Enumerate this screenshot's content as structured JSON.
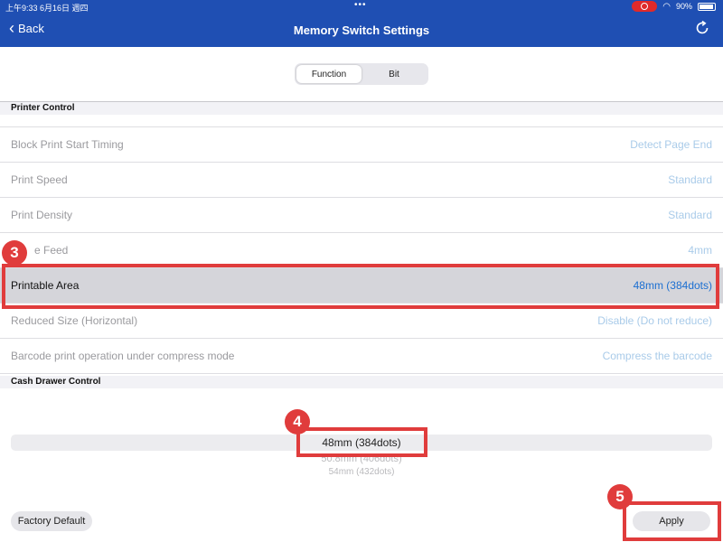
{
  "status_bar": {
    "time_date": "上午9:33   6月16日 週四",
    "battery": "90%"
  },
  "nav": {
    "back_label": "Back",
    "title": "Memory Switch Settings",
    "refresh_icon": "refresh-icon"
  },
  "segment": {
    "tabs": [
      {
        "label": "Function",
        "active": true
      },
      {
        "label": "Bit",
        "active": false
      }
    ]
  },
  "sections": {
    "printer_control": "Printer Control",
    "cash_drawer_control": "Cash Drawer Control"
  },
  "rows": [
    {
      "label": "Block Print Start Timing",
      "value": "Detect Page End"
    },
    {
      "label": "Print Speed",
      "value": "Standard"
    },
    {
      "label": "Print Density",
      "value": "Standard"
    },
    {
      "label": "e Feed",
      "value": "4mm"
    },
    {
      "label": "Printable Area",
      "value": "48mm (384dots)",
      "selected": true
    },
    {
      "label": "Reduced Size (Horizontal)",
      "value": "Disable (Do not reduce)"
    },
    {
      "label": "Barcode print operation under compress mode",
      "value": "Compress the barcode"
    }
  ],
  "picker": {
    "selected": "48mm (384dots)",
    "options_below": [
      "50.8mm (406dots)",
      "54mm (432dots)"
    ]
  },
  "callouts": [
    "3",
    "4",
    "5"
  ],
  "buttons": {
    "factory_default": "Factory Default",
    "apply": "Apply"
  },
  "colors": {
    "nav_blue": "#1f4fb3",
    "callout_red": "#e03c3c",
    "value_blue": "#1c6fd1",
    "value_light": "#a9cbe9"
  }
}
